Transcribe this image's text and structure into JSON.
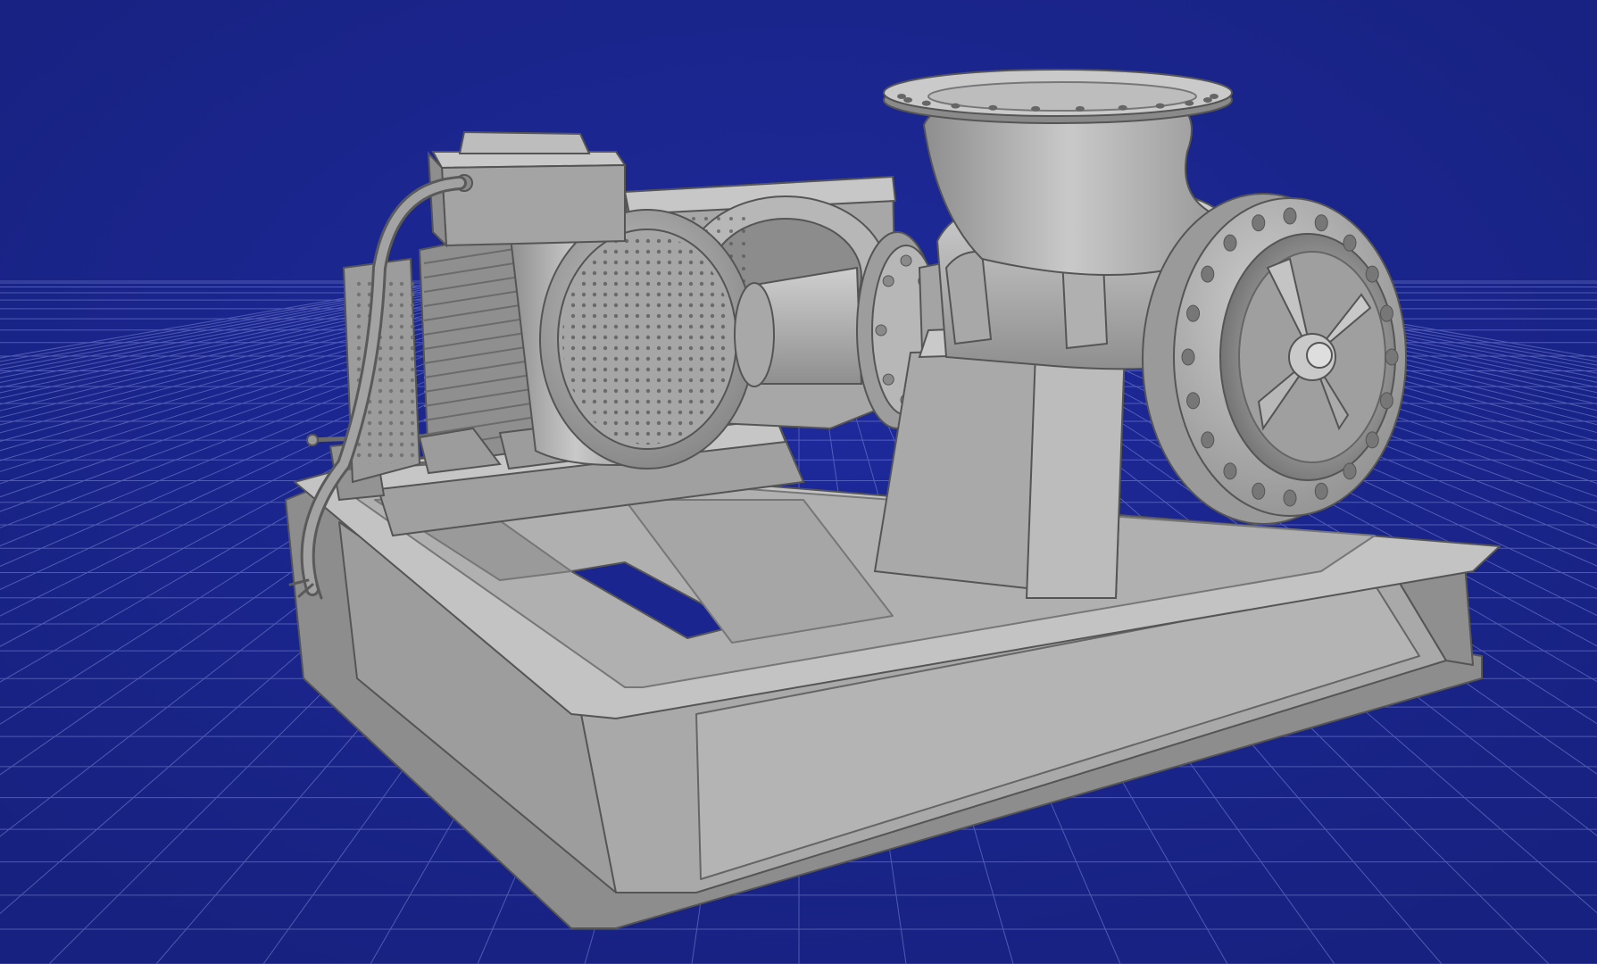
{
  "viewport": {
    "kind": "3d-model-viewer",
    "view": "perspective",
    "model": "horizontal-split-case-pump-skid",
    "components": [
      "electric-motor",
      "terminal-box",
      "power-cable",
      "drive-coupling",
      "coupling-guard",
      "pump-casing",
      "suction-flange",
      "discharge-flange",
      "impeller",
      "pump-support-pedestal",
      "base-frame"
    ],
    "colors": {
      "background": "#1a2590",
      "ground_grid": "#7d88d6",
      "model_light": "#c7c7c7",
      "model_mid": "#a3a3a3",
      "model_dark": "#6f6f6f",
      "model_outline": "#4e4e4e"
    },
    "ground_grid_visible": true
  }
}
